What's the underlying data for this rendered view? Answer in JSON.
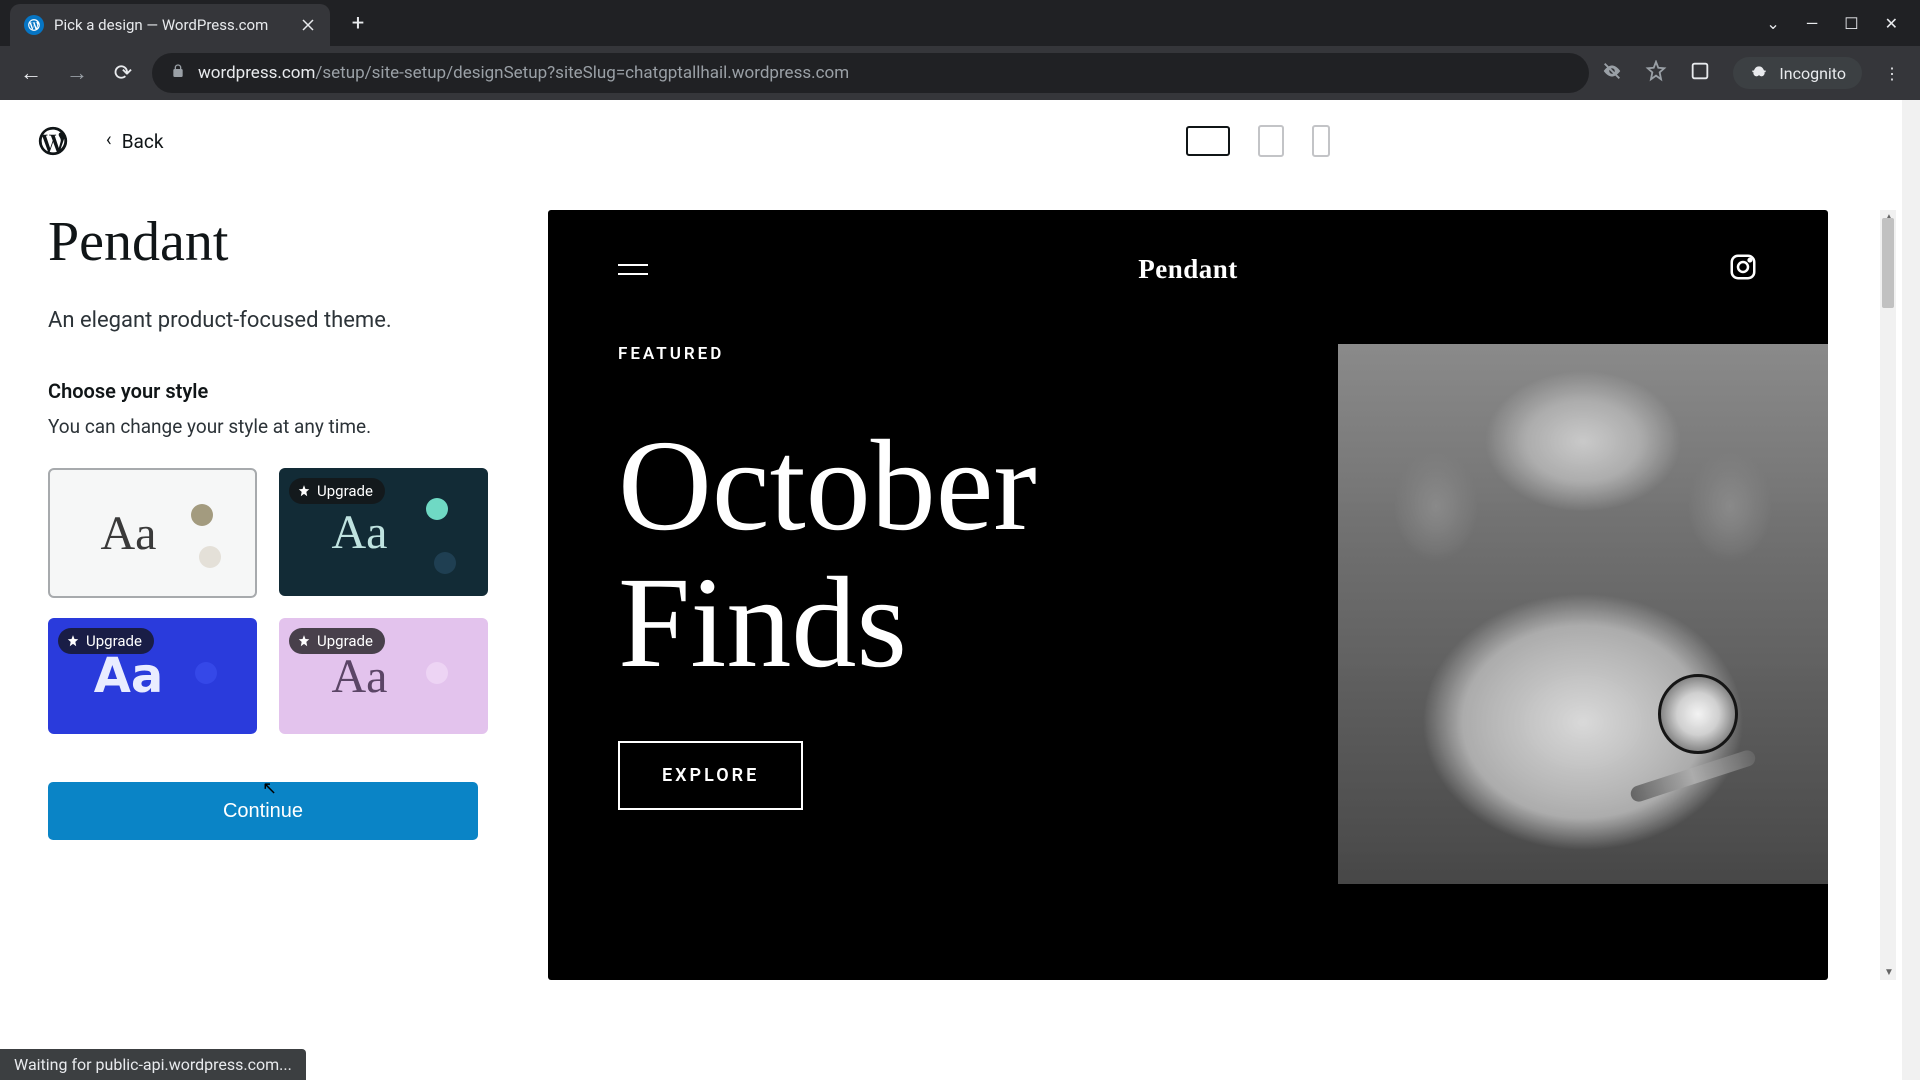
{
  "browser": {
    "tab_title": "Pick a design — WordPress.com",
    "url_domain": "wordpress.com",
    "url_path": "/setup/site-setup/designSetup?siteSlug=chatgptallhail.wordpress.com",
    "incognito_label": "Incognito"
  },
  "topbar": {
    "back_label": "Back"
  },
  "sidebar": {
    "theme_title": "Pendant",
    "theme_desc": "An elegant product-focused theme.",
    "style_heading": "Choose your style",
    "style_subtext": "You can change your style at any time.",
    "upgrade_label": "Upgrade",
    "continue_label": "Continue"
  },
  "preview": {
    "brand": "Pendant",
    "featured_label": "FEATURED",
    "headline_line1": "October",
    "headline_line2": "Finds",
    "explore_label": "EXPLORE"
  },
  "status": {
    "message": "Waiting for public-api.wordpress.com..."
  }
}
